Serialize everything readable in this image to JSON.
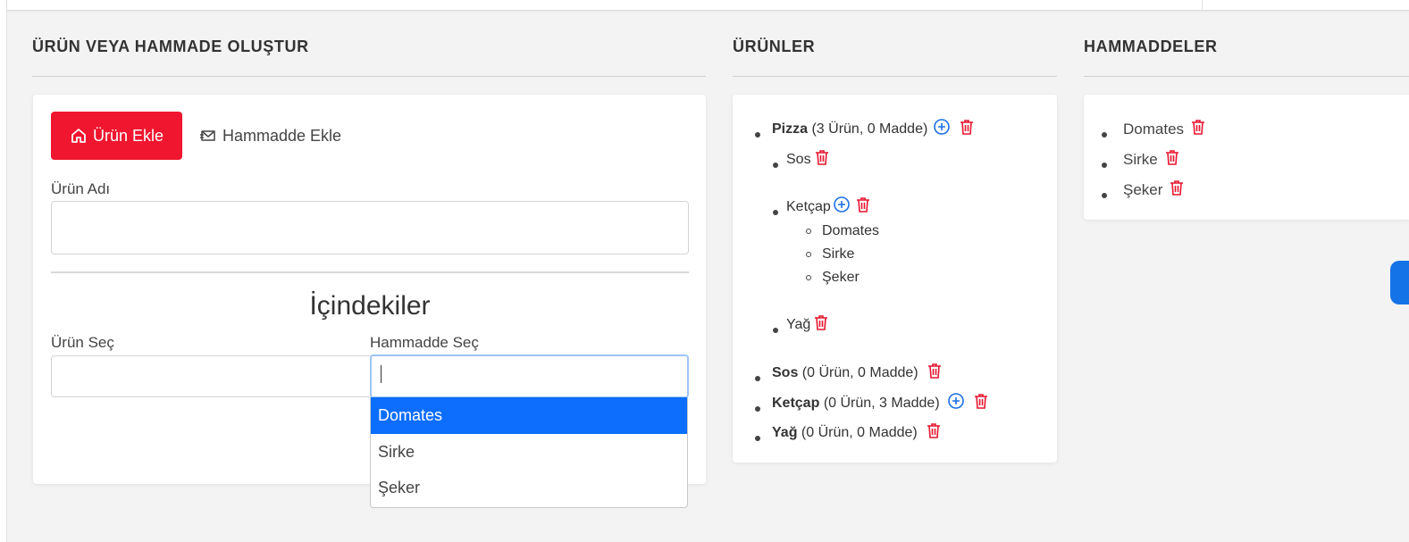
{
  "colors": {
    "primary_button": "#f0162f",
    "link_blue": "#0d6efd",
    "trash_red": "#e6152e",
    "plus_blue": "#1a6ee8"
  },
  "create_section": {
    "title": "ÜRÜN VEYA HAMMADE OLUŞTUR",
    "add_product_button": {
      "label": "Ürün Ekle",
      "icon": "home-icon"
    },
    "add_material_button": {
      "label": "Hammadde Ekle",
      "icon": "mail-icon"
    },
    "product_name_label": "Ürün Adı",
    "product_name_value": "",
    "ingredients_heading": "İçindekiler",
    "select_product_label": "Ürün Seç",
    "select_product_value": "",
    "select_material_label": "Hammadde Seç",
    "select_material_value": "",
    "material_options": [
      "Domates",
      "Sirke",
      "Şeker"
    ],
    "highlighted_option": "Domates"
  },
  "products_section": {
    "title": "ÜRÜNLER",
    "pizza": {
      "name": "Pizza",
      "meta": "(3 Ürün, 0 Madde)"
    },
    "pizza_children": {
      "sos": "Sos",
      "ketcap": "Ketçap",
      "ketcap_items": [
        "Domates",
        "Sirke",
        "Şeker"
      ],
      "yag": "Yağ"
    },
    "sos": {
      "name": "Sos",
      "meta": "(0 Ürün, 0 Madde)"
    },
    "ketcap": {
      "name": "Ketçap",
      "meta": "(0 Ürün, 3 Madde)"
    },
    "yag": {
      "name": "Yağ",
      "meta": "(0 Ürün, 0 Madde)"
    }
  },
  "materials_section": {
    "title": "HAMMADDELER",
    "items": [
      "Domates",
      "Sirke",
      "Şeker"
    ]
  }
}
